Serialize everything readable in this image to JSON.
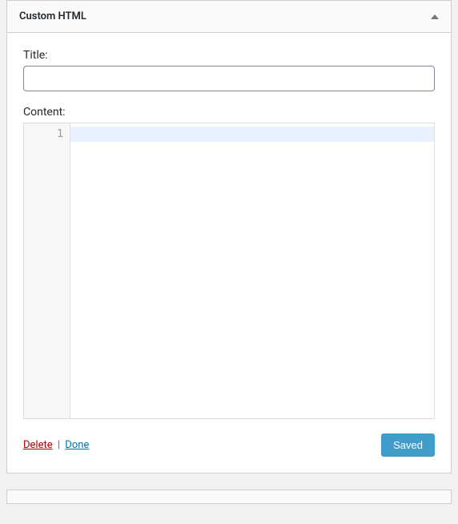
{
  "widget": {
    "title": "Custom HTML",
    "fields": {
      "title_label": "Title:",
      "title_value": "",
      "content_label": "Content:",
      "content_value": ""
    },
    "editor": {
      "line_number": "1"
    },
    "actions": {
      "delete": "Delete",
      "separator": "|",
      "done": "Done",
      "saved": "Saved"
    }
  }
}
